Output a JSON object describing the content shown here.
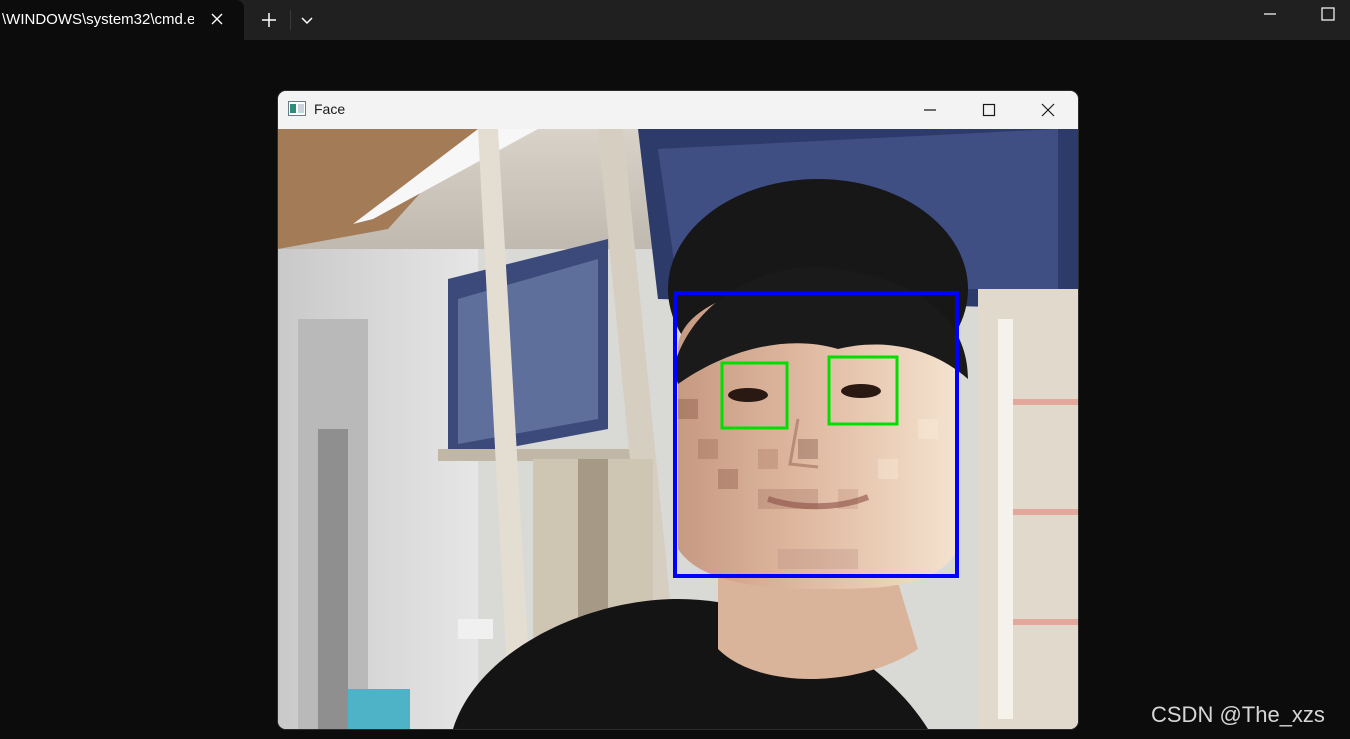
{
  "terminal": {
    "tab_title": "\\WINDOWS\\system32\\cmd.e",
    "tab_close_icon": "close-icon",
    "new_tab_icon": "plus-icon",
    "dropdown_icon": "chevron-down-icon",
    "minimize_icon": "minimize-icon",
    "maximize_icon": "maximize-icon"
  },
  "face_window": {
    "title": "Face",
    "app_icon": "opencv-window-icon",
    "minimize_icon": "minimize-icon",
    "maximize_icon": "maximize-icon",
    "close_icon": "close-icon"
  },
  "detection": {
    "face_box_color": "#0000ff",
    "eye_box_color": "#00e000",
    "face_region_pixelated": true,
    "detected_faces": 1,
    "detected_eyes": 2
  },
  "watermark": "CSDN @The_xzs"
}
